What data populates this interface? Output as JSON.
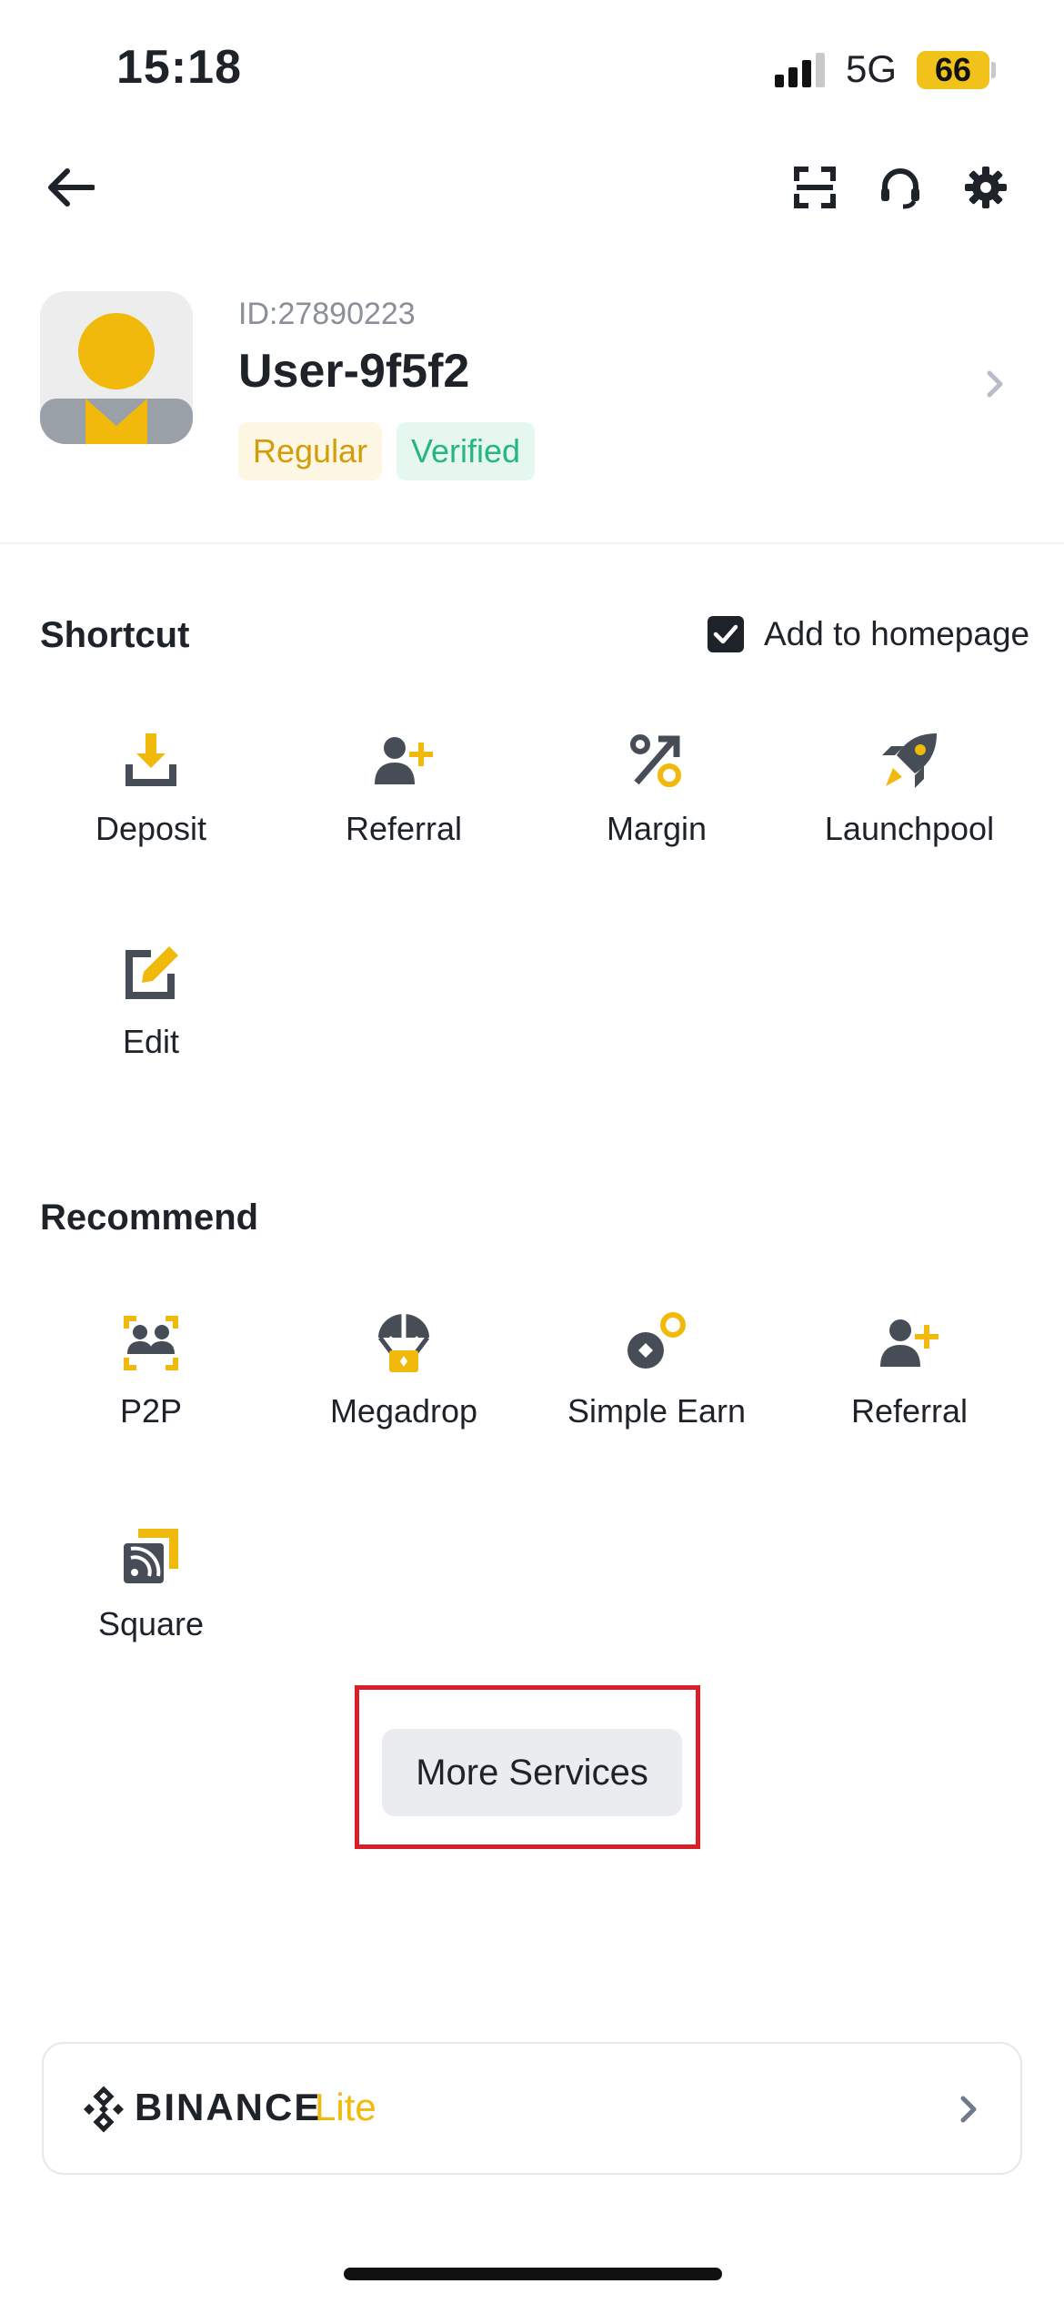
{
  "status_bar": {
    "time": "15:18",
    "network": "5G",
    "battery": "66"
  },
  "profile": {
    "id_label": "ID:27890223",
    "username": "User-9f5f2",
    "badges": [
      "Regular",
      "Verified"
    ]
  },
  "shortcut": {
    "title": "Shortcut",
    "add_to_homepage": "Add to homepage",
    "add_to_homepage_checked": true,
    "items": [
      {
        "label": "Deposit",
        "icon": "deposit-icon"
      },
      {
        "label": "Referral",
        "icon": "referral-icon"
      },
      {
        "label": "Margin",
        "icon": "margin-icon"
      },
      {
        "label": "Launchpool",
        "icon": "launchpool-icon"
      },
      {
        "label": "Edit",
        "icon": "edit-icon"
      }
    ]
  },
  "recommend": {
    "title": "Recommend",
    "items": [
      {
        "label": "P2P",
        "icon": "p2p-icon"
      },
      {
        "label": "Megadrop",
        "icon": "megadrop-icon"
      },
      {
        "label": "Simple Earn",
        "icon": "simple-earn-icon"
      },
      {
        "label": "Referral",
        "icon": "referral-icon"
      },
      {
        "label": "Square",
        "icon": "square-icon"
      }
    ]
  },
  "more_services": "More Services",
  "lite_card": {
    "brand": "BINANCE",
    "suffix": "Lite"
  },
  "colors": {
    "accent": "#F0B90B",
    "dark": "#1E2329",
    "verified": "#27B67D",
    "highlight": "#D9202A"
  }
}
